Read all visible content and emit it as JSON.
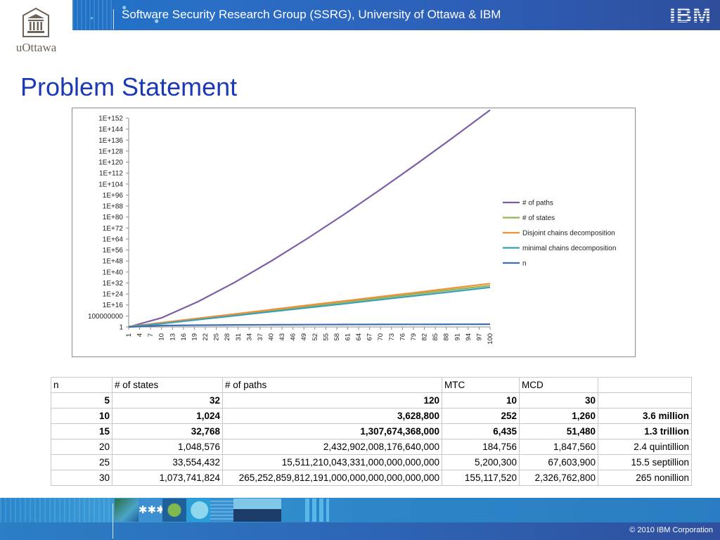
{
  "header": {
    "logo_text": "uOttawa",
    "banner_text": "Software Security Research Group (SSRG), University of Ottawa & IBM",
    "ibm_logo_text": "IBM"
  },
  "title": "Problem Statement",
  "chart_data": {
    "type": "line",
    "title": "",
    "xlabel": "",
    "ylabel": "",
    "y_scale": "log",
    "y_ticks": [
      "1",
      "100000000",
      "1E+16",
      "1E+24",
      "1E+32",
      "1E+40",
      "1E+48",
      "1E+56",
      "1E+64",
      "1E+72",
      "1E+80",
      "1E+88",
      "1E+96",
      "1E+104",
      "1E+112",
      "1E+120",
      "1E+128",
      "1E+136",
      "1E+144",
      "1E+152"
    ],
    "x_ticks": [
      "1",
      "4",
      "7",
      "10",
      "13",
      "16",
      "19",
      "22",
      "25",
      "28",
      "31",
      "34",
      "37",
      "40",
      "43",
      "46",
      "49",
      "52",
      "55",
      "58",
      "61",
      "64",
      "67",
      "70",
      "73",
      "76",
      "79",
      "82",
      "85",
      "88",
      "91",
      "94",
      "97",
      "100"
    ],
    "xlim": [
      1,
      100
    ],
    "legend_position": "right",
    "grid": false,
    "series": [
      {
        "name": "# of paths",
        "color": "#7b5ea7",
        "x": [
          1,
          10,
          20,
          30,
          40,
          50,
          60,
          70,
          80,
          90,
          100
        ],
        "log10_y": [
          0,
          6.6,
          18.4,
          32.4,
          47.9,
          64.5,
          81.9,
          100.1,
          118.9,
          138.2,
          157.9
        ]
      },
      {
        "name": "# of states",
        "color": "#94b454",
        "x": [
          1,
          10,
          20,
          30,
          40,
          50,
          60,
          70,
          80,
          90,
          100
        ],
        "log10_y": [
          0.3,
          3.0,
          6.0,
          9.0,
          12.0,
          15.1,
          18.1,
          21.1,
          24.1,
          27.1,
          30.1
        ]
      },
      {
        "name": "Disjoint chains decomposition",
        "color": "#f0913a",
        "x": [
          1,
          10,
          20,
          30,
          40,
          50,
          60,
          70,
          80,
          90,
          100
        ],
        "log10_y": [
          0,
          3.1,
          6.3,
          9.4,
          12.6,
          15.8,
          18.9,
          22.1,
          25.2,
          28.4,
          31.6
        ]
      },
      {
        "name": "minimal chains decomposition",
        "color": "#3aa0b8",
        "x": [
          1,
          10,
          20,
          30,
          40,
          50,
          60,
          70,
          80,
          90,
          100
        ],
        "log10_y": [
          0,
          2.4,
          5.3,
          8.2,
          11.1,
          14.0,
          16.9,
          19.9,
          22.8,
          25.8,
          28.8
        ]
      },
      {
        "name": "n",
        "color": "#3f6fb0",
        "x": [
          1,
          10,
          20,
          30,
          40,
          50,
          60,
          70,
          80,
          90,
          100
        ],
        "log10_y": [
          0,
          1.0,
          1.3,
          1.48,
          1.6,
          1.7,
          1.78,
          1.85,
          1.9,
          1.95,
          2.0
        ]
      }
    ]
  },
  "table": {
    "headers": [
      "n",
      "# of states",
      "# of paths",
      "MTC",
      "MCD",
      ""
    ],
    "rows": [
      {
        "bold": true,
        "cells": [
          "5",
          "32",
          "120",
          "10",
          "30",
          ""
        ]
      },
      {
        "bold": true,
        "cells": [
          "10",
          "1,024",
          "3,628,800",
          "252",
          "1,260",
          "3.6 million"
        ]
      },
      {
        "bold": true,
        "cells": [
          "15",
          "32,768",
          "1,307,674,368,000",
          "6,435",
          "51,480",
          "1.3 trillion"
        ]
      },
      {
        "bold": false,
        "cells": [
          "20",
          "1,048,576",
          "2,432,902,008,176,640,000",
          "184,756",
          "1,847,560",
          "2.4 quintillion"
        ]
      },
      {
        "bold": false,
        "cells": [
          "25",
          "33,554,432",
          "15,511,210,043,331,000,000,000,000",
          "5,200,300",
          "67,603,900",
          "15.5 septillion"
        ]
      },
      {
        "bold": false,
        "cells": [
          "30",
          "1,073,741,824",
          "265,252,859,812,191,000,000,000,000,000,000",
          "155,117,520",
          "2,326,762,800",
          "265 nonillion"
        ]
      }
    ]
  },
  "footer": {
    "copyright": "© 2010 IBM Corporation"
  },
  "colors": {
    "title": "#1b39b6",
    "banner": "#2d5fb8",
    "footer": "#2a86cc"
  }
}
